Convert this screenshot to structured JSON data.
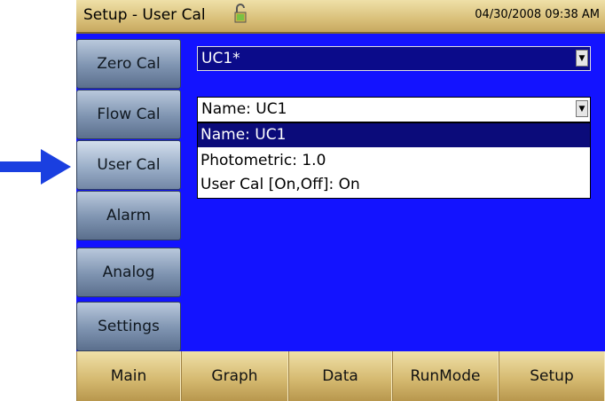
{
  "title": "Setup - User Cal",
  "datetime": "04/30/2008 09:38 AM",
  "sidebar": {
    "items": [
      {
        "label": "Zero Cal"
      },
      {
        "label": "Flow Cal"
      },
      {
        "label": "User Cal"
      },
      {
        "label": "Alarm"
      },
      {
        "label": "Analog"
      },
      {
        "label": "Settings"
      }
    ]
  },
  "calibration_select": {
    "value": "UC1*"
  },
  "parameter_select": {
    "value": "Name: UC1"
  },
  "parameter_options": [
    {
      "label": "Name: UC1",
      "selected": true
    },
    {
      "label": "Photometric: 1.0",
      "selected": false
    },
    {
      "label": "User Cal [On,Off]: On",
      "selected": false
    }
  ],
  "bottom_nav": [
    {
      "label": "Main"
    },
    {
      "label": "Graph"
    },
    {
      "label": "Data"
    },
    {
      "label": "RunMode"
    },
    {
      "label": "Setup"
    }
  ],
  "icons": {
    "pointer": "arrow-right-icon",
    "lock": "lock-open-icon",
    "dropdown": "chevron-down-icon"
  },
  "colors": {
    "background": "#1313ff",
    "title_bar": "#d9c07a",
    "sidebar_button": "#7e93b0",
    "selected_option": "#0b0b7a",
    "pointer_arrow": "#1a3fe0"
  }
}
